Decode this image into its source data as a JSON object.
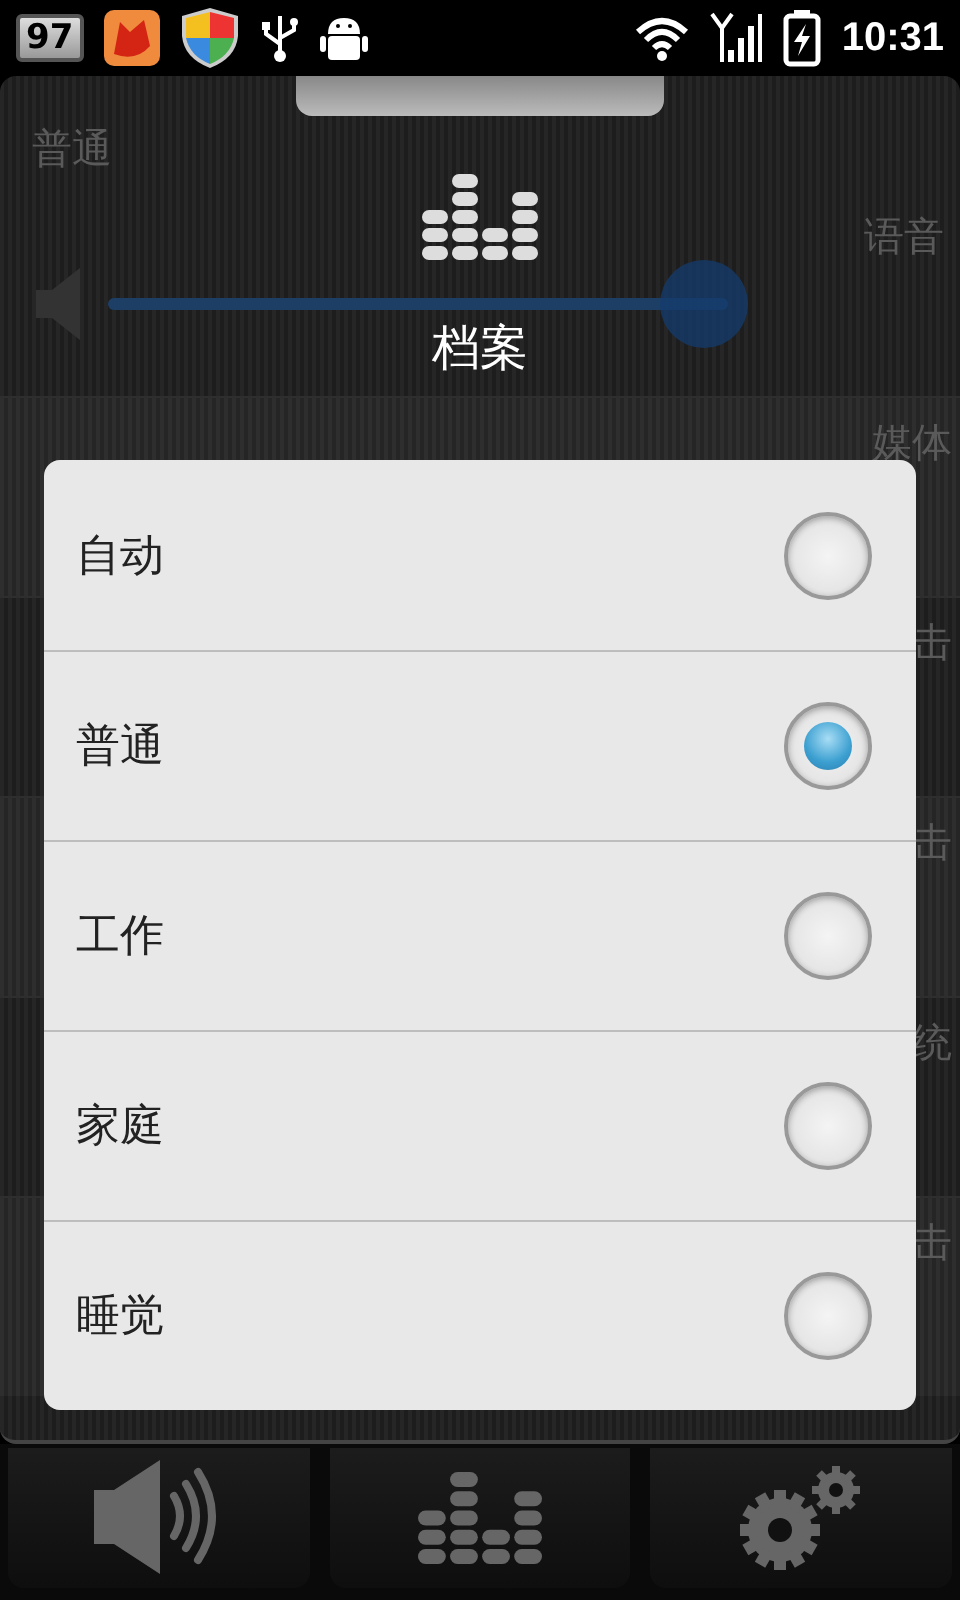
{
  "status_bar": {
    "battery_badge": "97",
    "time": "10:31"
  },
  "panel": {
    "profile_label": "普通",
    "volume": {
      "level": 0.96
    },
    "title": "档案",
    "side_labels": [
      "语音",
      "媒体",
      "击",
      "击",
      "统",
      "击"
    ]
  },
  "dialog": {
    "options": [
      {
        "label": "自动",
        "selected": false
      },
      {
        "label": "普通",
        "selected": true
      },
      {
        "label": "工作",
        "selected": false
      },
      {
        "label": "家庭",
        "selected": false
      },
      {
        "label": "睡觉",
        "selected": false
      }
    ]
  }
}
